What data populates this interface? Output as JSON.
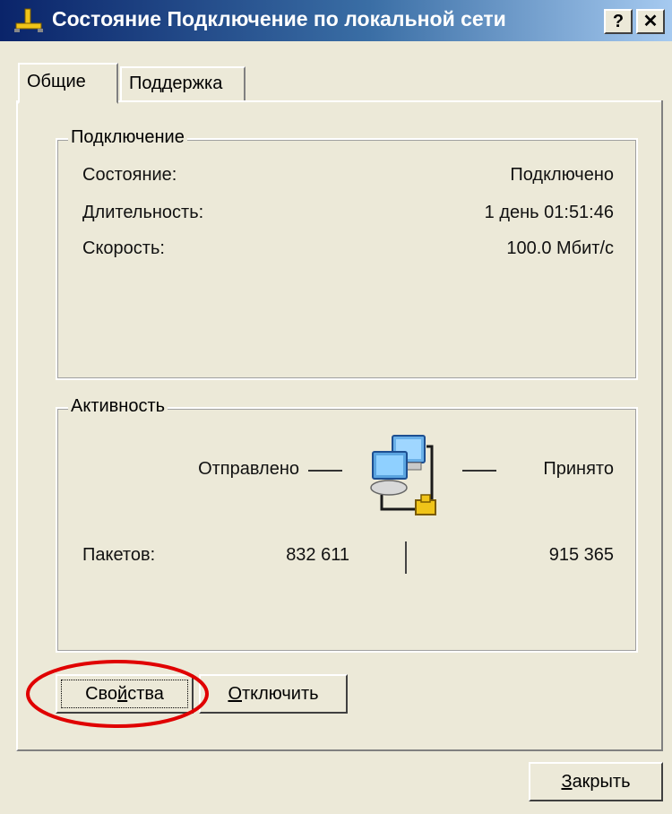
{
  "window": {
    "title": "Состояние Подключение по локальной сети",
    "help_label": "?",
    "close_label": "✕"
  },
  "tabs": [
    {
      "label": "Общие"
    },
    {
      "label": "Поддержка"
    }
  ],
  "connection": {
    "group_label": "Подключение",
    "rows": [
      {
        "label": "Состояние:",
        "value": "Подключено"
      },
      {
        "label": "Длительность:",
        "value": "1 день 01:51:46"
      },
      {
        "label": "Скорость:",
        "value": "100.0 Мбит/с"
      }
    ]
  },
  "activity": {
    "group_label": "Активность",
    "sent_label": "Отправлено",
    "received_label": "Принято",
    "packets_label": "Пакетов:",
    "packets_sent": "832 611",
    "packets_received": "915 365"
  },
  "buttons": {
    "properties_pre": "Сво",
    "properties_u": "й",
    "properties_post": "ства",
    "disconnect_u": "О",
    "disconnect_post": "тключить",
    "close_u": "З",
    "close_post": "акрыть"
  },
  "colors": {
    "title_bar": "#0a246a",
    "dialog_bg": "#ece9d8",
    "highlight_circle": "#e00000"
  },
  "icons": {
    "title": "network-plug-icon",
    "activity": "network-computers-icon"
  }
}
